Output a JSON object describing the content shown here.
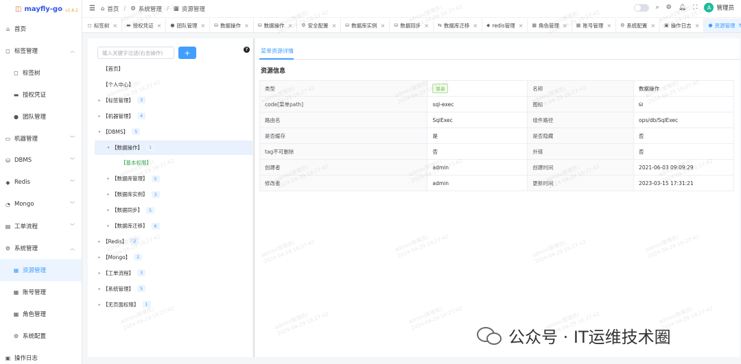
{
  "app": {
    "name": "mayfly-go",
    "version": "v1.8.2"
  },
  "header": {
    "breadcrumbs": [
      "首页",
      "系统管理",
      "资源管理"
    ],
    "username": "管理员",
    "avatar_letter": "A"
  },
  "sidebar": {
    "items": [
      {
        "label": "首页",
        "icon": "home-icon",
        "type": "top"
      },
      {
        "label": "标签管理",
        "icon": "tag-icon",
        "type": "top",
        "expanded": true
      },
      {
        "label": "标签树",
        "icon": "tag-icon",
        "type": "sub"
      },
      {
        "label": "授权凭证",
        "icon": "key-icon",
        "type": "sub"
      },
      {
        "label": "团队管理",
        "icon": "user-icon",
        "type": "sub"
      },
      {
        "label": "机器管理",
        "icon": "monitor-icon",
        "type": "top"
      },
      {
        "label": "DBMS",
        "icon": "database-icon",
        "type": "top"
      },
      {
        "label": "Redis",
        "icon": "redis-icon",
        "type": "top"
      },
      {
        "label": "Mongo",
        "icon": "mongo-icon",
        "type": "top"
      },
      {
        "label": "工单流程",
        "icon": "workflow-icon",
        "type": "top"
      },
      {
        "label": "系统管理",
        "icon": "gear-icon",
        "type": "top",
        "expanded": true
      },
      {
        "label": "资源管理",
        "icon": "grid-icon",
        "type": "sub",
        "active": true
      },
      {
        "label": "账号管理",
        "icon": "grid-icon",
        "type": "sub"
      },
      {
        "label": "角色管理",
        "icon": "grid-icon",
        "type": "sub"
      },
      {
        "label": "系统配置",
        "icon": "gear-icon",
        "type": "sub"
      },
      {
        "label": "操作日志",
        "icon": "doc-icon",
        "type": "top"
      }
    ]
  },
  "tabs": [
    {
      "label": "标签树",
      "icon": "tag-icon"
    },
    {
      "label": "授权凭证",
      "icon": "key-icon"
    },
    {
      "label": "团队管理",
      "icon": "user-icon"
    },
    {
      "label": "数据操作",
      "icon": "database-icon"
    },
    {
      "label": "数据操作",
      "icon": "database-icon"
    },
    {
      "label": "安全配置",
      "icon": "gear-icon"
    },
    {
      "label": "数据库实例",
      "icon": "database-icon"
    },
    {
      "label": "数据同步",
      "icon": "database-icon"
    },
    {
      "label": "数据库迁移",
      "icon": "transfer-icon"
    },
    {
      "label": "redis管理",
      "icon": "redis-icon"
    },
    {
      "label": "角色管理",
      "icon": "grid-icon"
    },
    {
      "label": "账号管理",
      "icon": "grid-icon"
    },
    {
      "label": "系统配置",
      "icon": "gear-icon"
    },
    {
      "label": "操作日志",
      "icon": "doc-icon"
    },
    {
      "label": "资源管理",
      "icon": "dot-icon",
      "active": true
    }
  ],
  "tree": {
    "search_placeholder": "输入关键字过滤(右击操作)",
    "add_label": "+",
    "nodes": [
      {
        "label": "【首页】",
        "level": 0,
        "caret": ""
      },
      {
        "label": "【个人中心】",
        "level": 0,
        "caret": ""
      },
      {
        "label": "【标签管理】",
        "level": 0,
        "caret": "▸",
        "count": "3"
      },
      {
        "label": "【机器管理】",
        "level": 0,
        "caret": "▸",
        "count": "4"
      },
      {
        "label": "【DBMS】",
        "level": 0,
        "caret": "▾",
        "count": "5"
      },
      {
        "label": "【数据操作】",
        "level": 1,
        "caret": "▾",
        "count": "1",
        "selected": true
      },
      {
        "label": "【基本权限】",
        "level": 2,
        "caret": "",
        "green": true
      },
      {
        "label": "【数据库管理】",
        "level": 1,
        "caret": "▸",
        "count": "5"
      },
      {
        "label": "【数据库实例】",
        "level": 1,
        "caret": "▸",
        "count": "3"
      },
      {
        "label": "【数据同步】",
        "level": 1,
        "caret": "▸",
        "count": "5"
      },
      {
        "label": "【数据库迁移】",
        "level": 1,
        "caret": "▸",
        "count": "6"
      },
      {
        "label": "【Redis】",
        "level": 0,
        "caret": "▸",
        "count": "2"
      },
      {
        "label": "【Mongo】",
        "level": 0,
        "caret": "▸",
        "count": "2"
      },
      {
        "label": "【工单流程】",
        "level": 0,
        "caret": "▸",
        "count": "3"
      },
      {
        "label": "【系统管理】",
        "level": 0,
        "caret": "▸",
        "count": "5"
      },
      {
        "label": "【无页面权限】",
        "level": 0,
        "caret": "▸",
        "count": "1"
      }
    ]
  },
  "detail": {
    "tab_label": "菜单资源详情",
    "section_title": "资源信息",
    "rows": [
      {
        "k1": "类型",
        "v1": "菜单",
        "v1_tag": true,
        "k2": "名称",
        "v2": "数据操作"
      },
      {
        "k1": "code[菜单path]",
        "v1": "sql-exec",
        "k2": "图标",
        "v2": "⛁"
      },
      {
        "k1": "路由名",
        "v1": "SqlExec",
        "k2": "组件路径",
        "v2": "ops/db/SqlExec"
      },
      {
        "k1": "是否缓存",
        "v1": "是",
        "k2": "是否隐藏",
        "v2": "否"
      },
      {
        "k1": "tag不可删除",
        "v1": "否",
        "k2": "外链",
        "v2": "否"
      },
      {
        "k1": "创建者",
        "v1": "admin",
        "k2": "创建时间",
        "v2": "2021-06-03 09:09:29"
      },
      {
        "k1": "修改者",
        "v1": "admin",
        "k2": "更新时间",
        "v2": "2023-03-15 17:31:21"
      }
    ]
  },
  "watermark": {
    "line1": "admin(管理员)",
    "line2": "2024-04-29 16:27:42"
  },
  "brand": {
    "text": "公众号 · IT运维技术圈"
  }
}
